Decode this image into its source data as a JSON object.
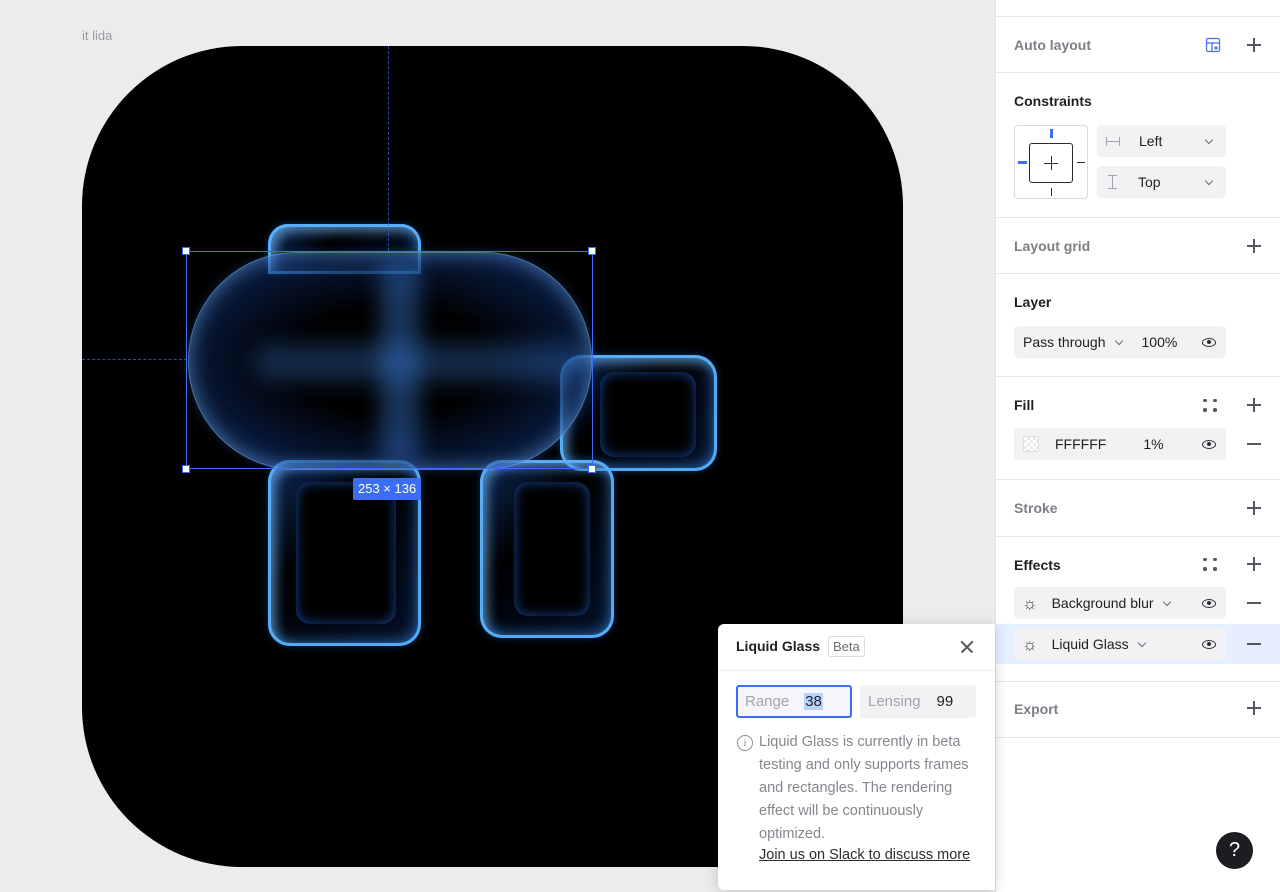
{
  "canvas": {
    "frame_label": "it lida",
    "selection_size": "253 × 136"
  },
  "panel": {
    "auto_layout": {
      "title": "Auto layout"
    },
    "constraints": {
      "title": "Constraints",
      "horizontal": "Left",
      "vertical": "Top"
    },
    "layout_grid": {
      "title": "Layout grid"
    },
    "layer": {
      "title": "Layer",
      "blend_mode": "Pass through",
      "opacity": "100%"
    },
    "fill": {
      "title": "Fill",
      "color_hex": "FFFFFF",
      "opacity": "1%"
    },
    "stroke": {
      "title": "Stroke"
    },
    "effects": {
      "title": "Effects",
      "items": [
        {
          "label": "Background blur"
        },
        {
          "label": "Liquid Glass"
        }
      ]
    },
    "export": {
      "title": "Export"
    }
  },
  "popup": {
    "title": "Liquid Glass",
    "badge": "Beta",
    "range_label": "Range",
    "range_value": "38",
    "lensing_label": "Lensing",
    "lensing_value": "99",
    "info": "Liquid Glass is currently in beta testing and only supports frames and rectangles. The rendering effect will be continuously optimized.",
    "link": "Join us on Slack to discuss more"
  },
  "help_label": "?",
  "colors": {
    "accent": "#3b6df5",
    "selected_row": "#e6efff",
    "frame_bg": "#000000"
  }
}
